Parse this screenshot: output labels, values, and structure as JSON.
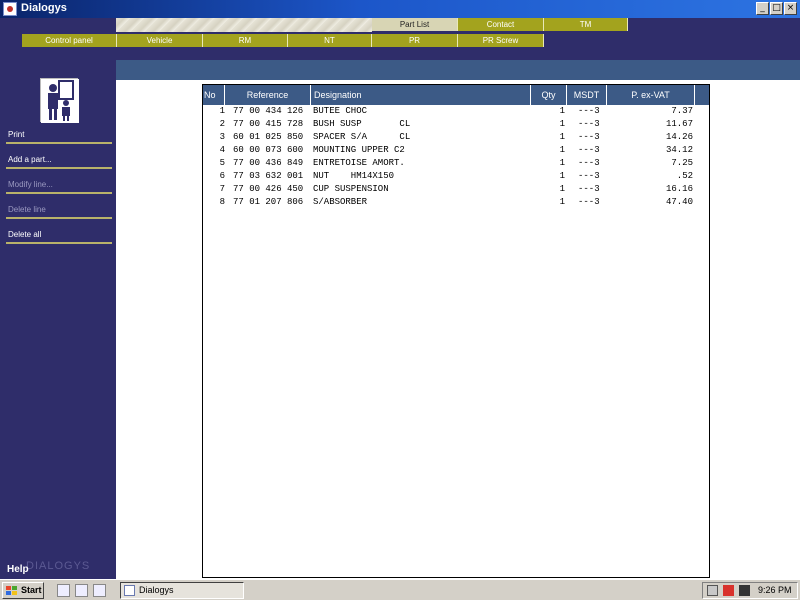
{
  "window": {
    "title": "Dialogys"
  },
  "tabs_row1": [
    {
      "label": "Part List",
      "active": true
    },
    {
      "label": "Contact",
      "active": false
    },
    {
      "label": "TM",
      "active": false
    }
  ],
  "tabs_row2": [
    {
      "label": "Control panel"
    },
    {
      "label": "Vehicle"
    },
    {
      "label": "RM"
    },
    {
      "label": "NT"
    },
    {
      "label": "PR"
    },
    {
      "label": "PR Screw"
    }
  ],
  "sidebar": {
    "items": [
      {
        "label": "Print",
        "enabled": true
      },
      {
        "label": "Add a part...",
        "enabled": true
      },
      {
        "label": "Modify line...",
        "enabled": false
      },
      {
        "label": "Delete line",
        "enabled": false
      },
      {
        "label": "Delete all",
        "enabled": true
      }
    ],
    "brand": "DIALOGYS",
    "help": "Help"
  },
  "table": {
    "columns": [
      "No",
      "Reference",
      "Designation",
      "Qty",
      "MSDT",
      "P. ex-VAT"
    ],
    "rows": [
      {
        "no": "1",
        "ref": "77 00 434 126",
        "des": "BUTEE CHOC",
        "qty": "1",
        "msdt": "---3",
        "price": "7.37"
      },
      {
        "no": "2",
        "ref": "77 00 415 728",
        "des": "BUSH SUSP       CL",
        "qty": "1",
        "msdt": "---3",
        "price": "11.67"
      },
      {
        "no": "3",
        "ref": "60 01 025 850",
        "des": "SPACER S/A      CL",
        "qty": "1",
        "msdt": "---3",
        "price": "14.26"
      },
      {
        "no": "4",
        "ref": "60 00 073 600",
        "des": "MOUNTING UPPER C2",
        "qty": "1",
        "msdt": "---3",
        "price": "34.12"
      },
      {
        "no": "5",
        "ref": "77 00 436 849",
        "des": "ENTRETOISE AMORT.",
        "qty": "1",
        "msdt": "---3",
        "price": "7.25"
      },
      {
        "no": "6",
        "ref": "77 03 632 001",
        "des": "NUT    HM14X150",
        "qty": "1",
        "msdt": "---3",
        "price": ".52"
      },
      {
        "no": "7",
        "ref": "77 00 426 450",
        "des": "CUP SUSPENSION",
        "qty": "1",
        "msdt": "---3",
        "price": "16.16"
      },
      {
        "no": "8",
        "ref": "77 01 207 806",
        "des": "S/ABSORBER",
        "qty": "1",
        "msdt": "---3",
        "price": "47.40"
      }
    ]
  },
  "taskbar": {
    "start_label": "Start",
    "task_label": "Dialogys",
    "clock": "9:26 PM"
  },
  "colors": {
    "navy": "#2f2d6a",
    "olive_tab": "#a3a31e",
    "header_blue": "#3c5a86"
  }
}
